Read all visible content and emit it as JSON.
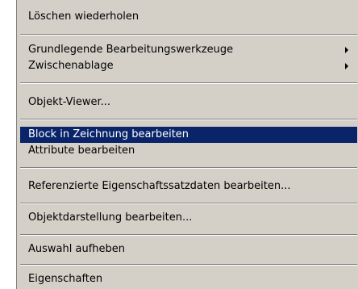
{
  "context_menu": {
    "items": [
      {
        "label": "Löschen wiederholen"
      },
      {
        "label": "Grundlegende Bearbeitungswerkzeuge",
        "submenu": true
      },
      {
        "label": "Zwischenablage",
        "submenu": true
      },
      {
        "label": "Objekt-Viewer..."
      },
      {
        "label": "Block in Zeichnung bearbeiten",
        "selected": true
      },
      {
        "label": "Attribute bearbeiten"
      },
      {
        "label": "Referenzierte Eigenschaftssatzdaten bearbeiten..."
      },
      {
        "label": "Objektdarstellung bearbeiten..."
      },
      {
        "label": "Auswahl aufheben"
      },
      {
        "label": "Eigenschaften"
      }
    ],
    "colors": {
      "menu_background": "#d4d0c8",
      "highlight_background": "#0a246a",
      "highlight_text": "#ffffff",
      "text": "#000000"
    },
    "icons": {
      "submenu": "submenu-arrow-icon"
    }
  }
}
